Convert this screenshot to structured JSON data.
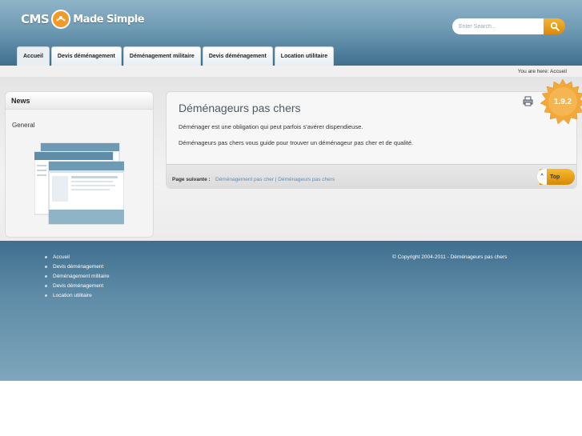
{
  "logo": {
    "text": "CMS",
    "text2": "Made Simple"
  },
  "search": {
    "placeholder": "Enter Search..."
  },
  "tabs": [
    {
      "label": "Accueil",
      "active": true
    },
    {
      "label": "Devis déménagement",
      "active": false
    },
    {
      "label": "Déménagement militaire",
      "active": false
    },
    {
      "label": "Devis déménagement",
      "active": false
    },
    {
      "label": "Location utilitaire",
      "active": false
    }
  ],
  "breadcrumb": {
    "text": "You are here: Accueil"
  },
  "sidebar": {
    "title": "News",
    "link": "General"
  },
  "main": {
    "title": "Déménageurs pas chers",
    "p1": "Déménager est une obligation qui peut parfois s'avérer dispendieuse.",
    "p2": "Déménageurs pas chers vous guide pour trouver un déménageur pas cher et de qualité.",
    "next_label": "Page suivante :",
    "next_links": "Déménagement pas cher | Déménageurs pas chers",
    "top_label": "Top",
    "top_arrow": "^"
  },
  "badge": {
    "version": "1.9.2"
  },
  "footer": {
    "nav": [
      "Accueil",
      "Devis déménagement",
      "Déménagement militaire",
      "Devis déménagement",
      "Location utilitaire"
    ],
    "copyright": "© Copyright 2004-2011 - Déménageurs pas chers"
  },
  "colors": {
    "accent": "#f0a020",
    "header": "#6e9ab3",
    "footer": "#3f6f8f",
    "link": "#5b8db3"
  },
  "icons": [
    "search-icon",
    "print-icon",
    "cms-logo-icon"
  ]
}
